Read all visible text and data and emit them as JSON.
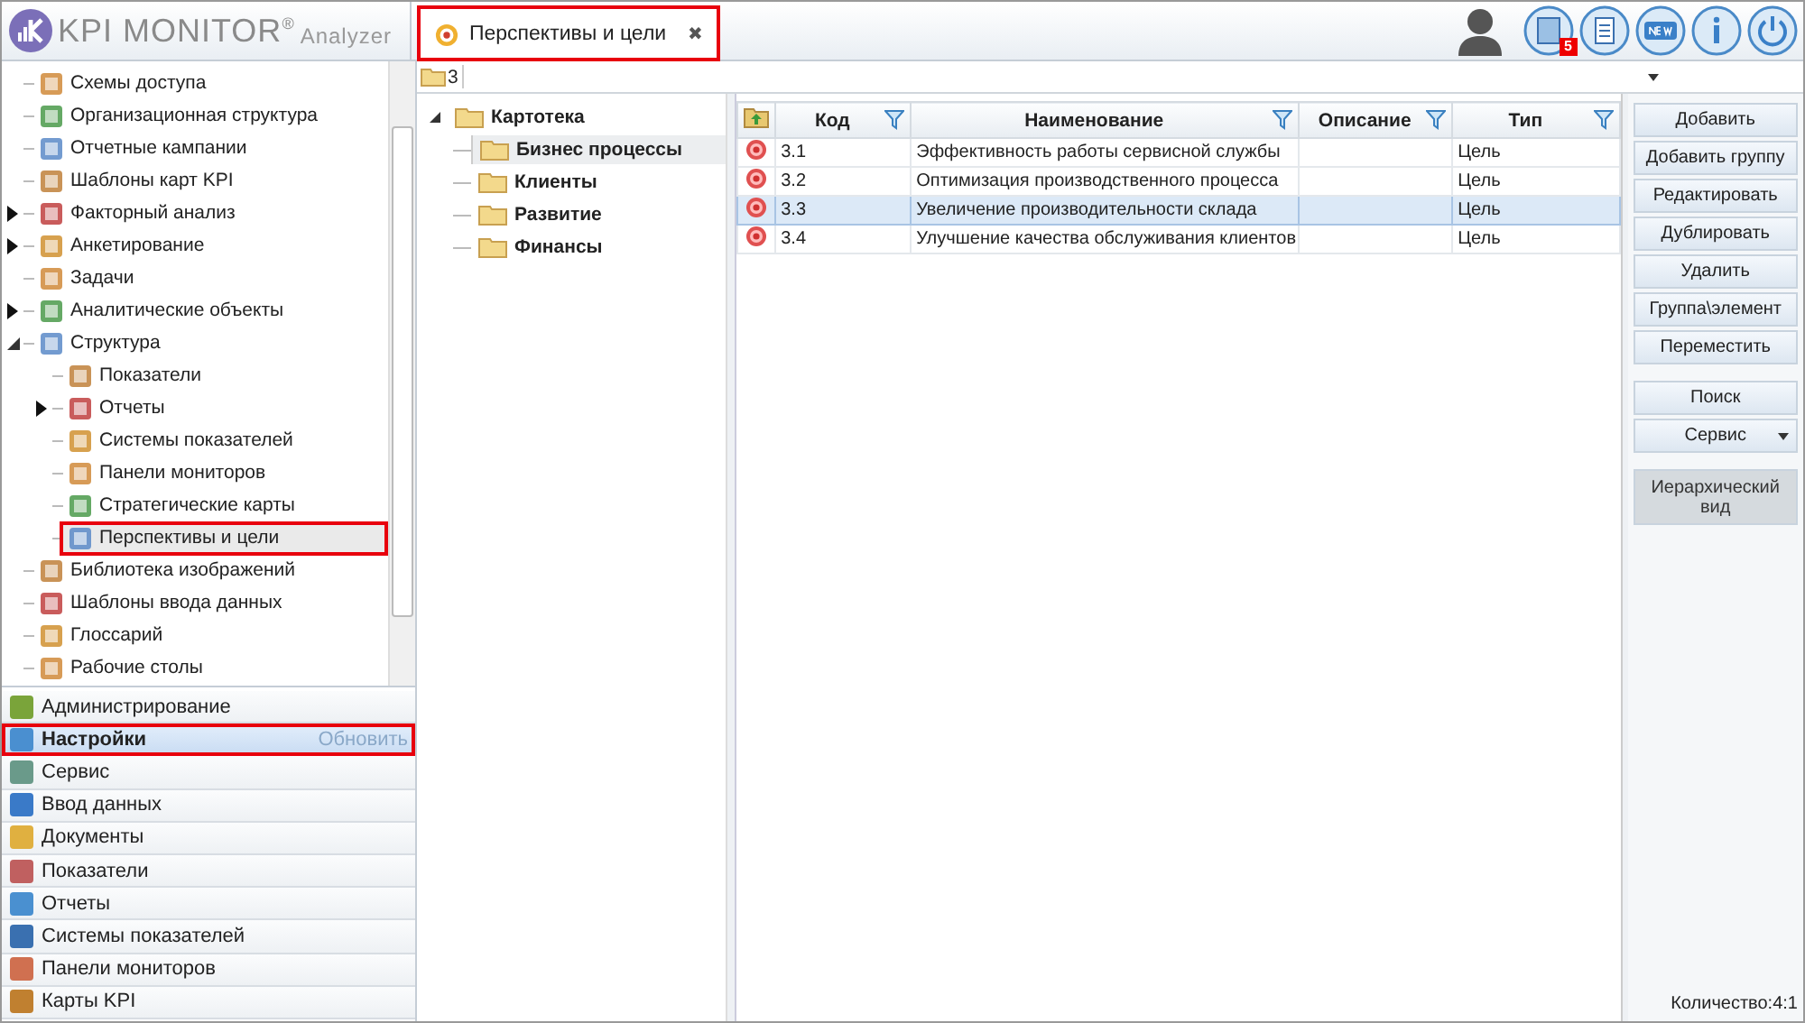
{
  "header": {
    "logo": "KPI MONITOR$^{®}$",
    "logo_sub": "Analyzer",
    "tab": {
      "label": "Перспективы и цели",
      "close": "✖",
      "highlighted": true
    },
    "notification_count": "5"
  },
  "nav_tree": [
    {
      "label": "Схемы доступа",
      "kind": "leaf",
      "selected": false,
      "highlighted": false
    },
    {
      "label": "Организационная структура",
      "kind": "leaf",
      "selected": false,
      "highlighted": false
    },
    {
      "label": "Отчетные кампании",
      "kind": "leaf",
      "selected": false,
      "highlighted": false
    },
    {
      "label": "Шаблоны карт KPI",
      "kind": "leaf",
      "selected": false,
      "highlighted": false
    },
    {
      "label": "Факторный анализ",
      "kind": "branch",
      "expanded": false,
      "selected": false,
      "highlighted": false
    },
    {
      "label": "Анкетирование",
      "kind": "branch",
      "expanded": false,
      "selected": false,
      "highlighted": false
    },
    {
      "label": "Задачи",
      "kind": "leaf",
      "selected": false,
      "highlighted": false
    },
    {
      "label": "Аналитические объекты",
      "kind": "branch",
      "expanded": false,
      "selected": false,
      "highlighted": false
    },
    {
      "label": "Структура",
      "kind": "branch",
      "expanded": true,
      "selected": false,
      "highlighted": false,
      "children": [
        {
          "label": "Показатели",
          "kind": "leaf",
          "selected": false,
          "highlighted": false
        },
        {
          "label": "Отчеты",
          "kind": "branch",
          "expanded": false,
          "selected": false,
          "highlighted": false
        },
        {
          "label": "Системы показателей",
          "kind": "leaf",
          "selected": false,
          "highlighted": false
        },
        {
          "label": "Панели мониторов",
          "kind": "leaf",
          "selected": false,
          "highlighted": false
        },
        {
          "label": "Стратегические карты",
          "kind": "leaf",
          "selected": false,
          "highlighted": false
        },
        {
          "label": "Перспективы и цели",
          "kind": "leaf",
          "selected": true,
          "highlighted": true
        }
      ]
    },
    {
      "label": "Библиотека изображений",
      "kind": "leaf",
      "selected": false,
      "highlighted": false
    },
    {
      "label": "Шаблоны ввода данных",
      "kind": "leaf",
      "selected": false,
      "highlighted": false
    },
    {
      "label": "Глоссарий",
      "kind": "leaf",
      "selected": false,
      "highlighted": false
    },
    {
      "label": "Рабочие столы",
      "kind": "leaf",
      "selected": false,
      "highlighted": false
    }
  ],
  "nav_sections": [
    {
      "label": "Администрирование",
      "selected": false,
      "highlighted": false,
      "color": "#7aa43a"
    },
    {
      "label": "Настройки",
      "selected": true,
      "highlighted": true,
      "action": "Обновить",
      "color": "#4a8fd0"
    },
    {
      "label": "Сервис",
      "selected": false,
      "highlighted": false,
      "color": "#6a9a8a"
    },
    {
      "label": "Ввод данных",
      "selected": false,
      "highlighted": false,
      "color": "#3a7ac8"
    },
    {
      "label": "Документы",
      "selected": false,
      "highlighted": false,
      "color": "#e0b040"
    },
    {
      "label": "Показатели",
      "selected": false,
      "highlighted": false,
      "color": "#c06060"
    },
    {
      "label": "Отчеты",
      "selected": false,
      "highlighted": false,
      "color": "#4a90d0"
    },
    {
      "label": "Системы показателей",
      "selected": false,
      "highlighted": false,
      "color": "#3a70b0"
    },
    {
      "label": "Панели мониторов",
      "selected": false,
      "highlighted": false,
      "color": "#d07050"
    },
    {
      "label": "Карты KPI",
      "selected": false,
      "highlighted": false,
      "color": "#c08030"
    }
  ],
  "breadcrumb": "3",
  "folder_tree": {
    "label": "Картотека",
    "expanded": true,
    "children": [
      {
        "label": "Бизнес процессы",
        "selected": true
      },
      {
        "label": "Клиенты",
        "selected": false
      },
      {
        "label": "Развитие",
        "selected": false
      },
      {
        "label": "Финансы",
        "selected": false
      }
    ]
  },
  "table": {
    "columns": [
      "Код",
      "Наименование",
      "Описание",
      "Тип"
    ],
    "rows": [
      {
        "code": "3.1",
        "name": "Эффективность работы сервисной службы",
        "type": "Цель",
        "selected": false
      },
      {
        "code": "3.2",
        "name": "Оптимизация производственного процесса",
        "type": "Цель",
        "selected": false
      },
      {
        "code": "3.3",
        "name": "Увеличение производительности склада",
        "type": "Цель",
        "selected": true
      },
      {
        "code": "3.4",
        "name": "Улучшение качества обслуживания клиентов",
        "type": "Цель",
        "selected": false
      }
    ]
  },
  "button_groups": [
    [
      {
        "label": "Добавить",
        "kind": "button",
        "pressed": false
      },
      {
        "label": "Добавить группу",
        "kind": "button",
        "pressed": false
      },
      {
        "label": "Редактировать",
        "kind": "button",
        "pressed": false
      },
      {
        "label": "Дублировать",
        "kind": "button",
        "pressed": false
      },
      {
        "label": "Удалить",
        "kind": "button",
        "pressed": false
      },
      {
        "label": "Группа\\элемент",
        "kind": "button",
        "pressed": false
      },
      {
        "label": "Переместить",
        "kind": "button",
        "pressed": false
      }
    ],
    [
      {
        "label": "Поиск",
        "kind": "button",
        "pressed": false
      },
      {
        "label": "Сервис",
        "kind": "dropdown",
        "pressed": false
      }
    ],
    [
      {
        "label": "Иерархический вид",
        "kind": "button",
        "pressed": true
      }
    ]
  ],
  "status": "Количество:4:1"
}
